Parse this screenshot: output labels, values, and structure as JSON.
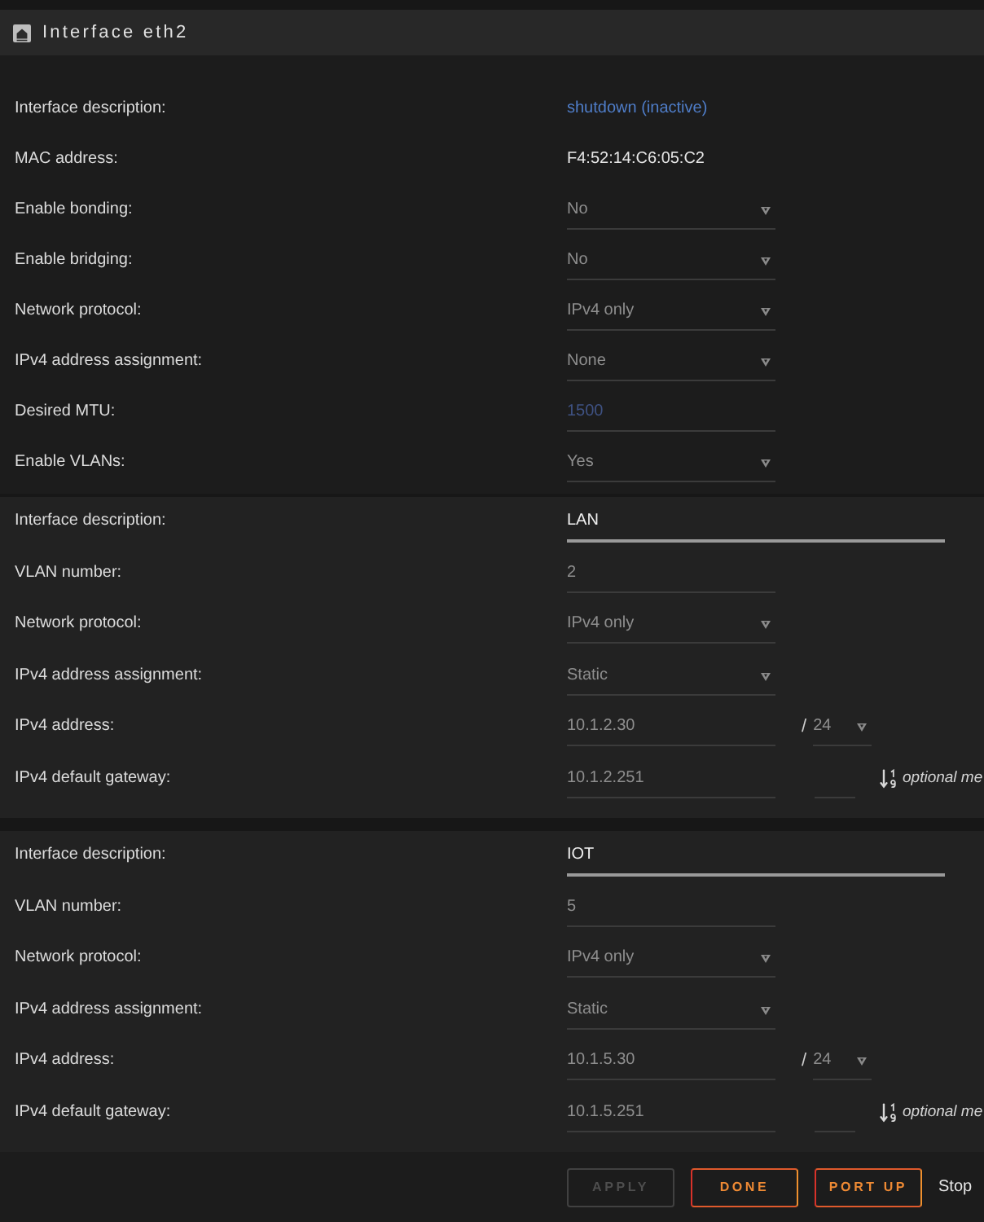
{
  "header": {
    "title": "Interface eth2"
  },
  "sections": [
    {
      "rows": [
        {
          "label": "Interface description:",
          "kind": "link",
          "value": "shutdown (inactive)"
        },
        {
          "label": "MAC address:",
          "kind": "static",
          "value": "F4:52:14:C6:05:C2"
        },
        {
          "label": "Enable bonding:",
          "kind": "select",
          "value": "No"
        },
        {
          "label": "Enable bridging:",
          "kind": "select",
          "value": "No"
        },
        {
          "label": "Network protocol:",
          "kind": "select",
          "value": "IPv4 only"
        },
        {
          "label": "IPv4 address assignment:",
          "kind": "select",
          "value": "None"
        },
        {
          "label": "Desired MTU:",
          "kind": "input",
          "placeholder": "1500"
        },
        {
          "label": "Enable VLANs:",
          "kind": "select",
          "value": "Yes"
        }
      ]
    },
    {
      "rows": [
        {
          "label": "Interface description:",
          "kind": "wide_input",
          "value": "LAN"
        },
        {
          "label": "VLAN number:",
          "kind": "input",
          "value": "2"
        },
        {
          "label": "Network protocol:",
          "kind": "select",
          "value": "IPv4 only"
        },
        {
          "label": "IPv4 address assignment:",
          "kind": "select",
          "value": "Static"
        },
        {
          "label": "IPv4 address:",
          "kind": "address",
          "value": "10.1.2.30",
          "separator": "/",
          "prefix": "24"
        },
        {
          "label": "IPv4 default gateway:",
          "kind": "gateway",
          "value": "10.1.2.251",
          "hint": "optional me"
        }
      ]
    },
    {
      "rows": [
        {
          "label": "Interface description:",
          "kind": "wide_input",
          "value": "IOT"
        },
        {
          "label": "VLAN number:",
          "kind": "input",
          "value": "5"
        },
        {
          "label": "Network protocol:",
          "kind": "select",
          "value": "IPv4 only"
        },
        {
          "label": "IPv4 address assignment:",
          "kind": "select",
          "value": "Static"
        },
        {
          "label": "IPv4 address:",
          "kind": "address",
          "value": "10.1.5.30",
          "separator": "/",
          "prefix": "24"
        },
        {
          "label": "IPv4 default gateway:",
          "kind": "gateway",
          "value": "10.1.5.251",
          "hint": "optional me"
        }
      ]
    }
  ],
  "buttons": [
    {
      "label": "APPLY",
      "disabled": true
    },
    {
      "label": "DONE",
      "disabled": false
    },
    {
      "label": "PORT UP",
      "disabled": false
    }
  ],
  "footer_text": "Stop"
}
